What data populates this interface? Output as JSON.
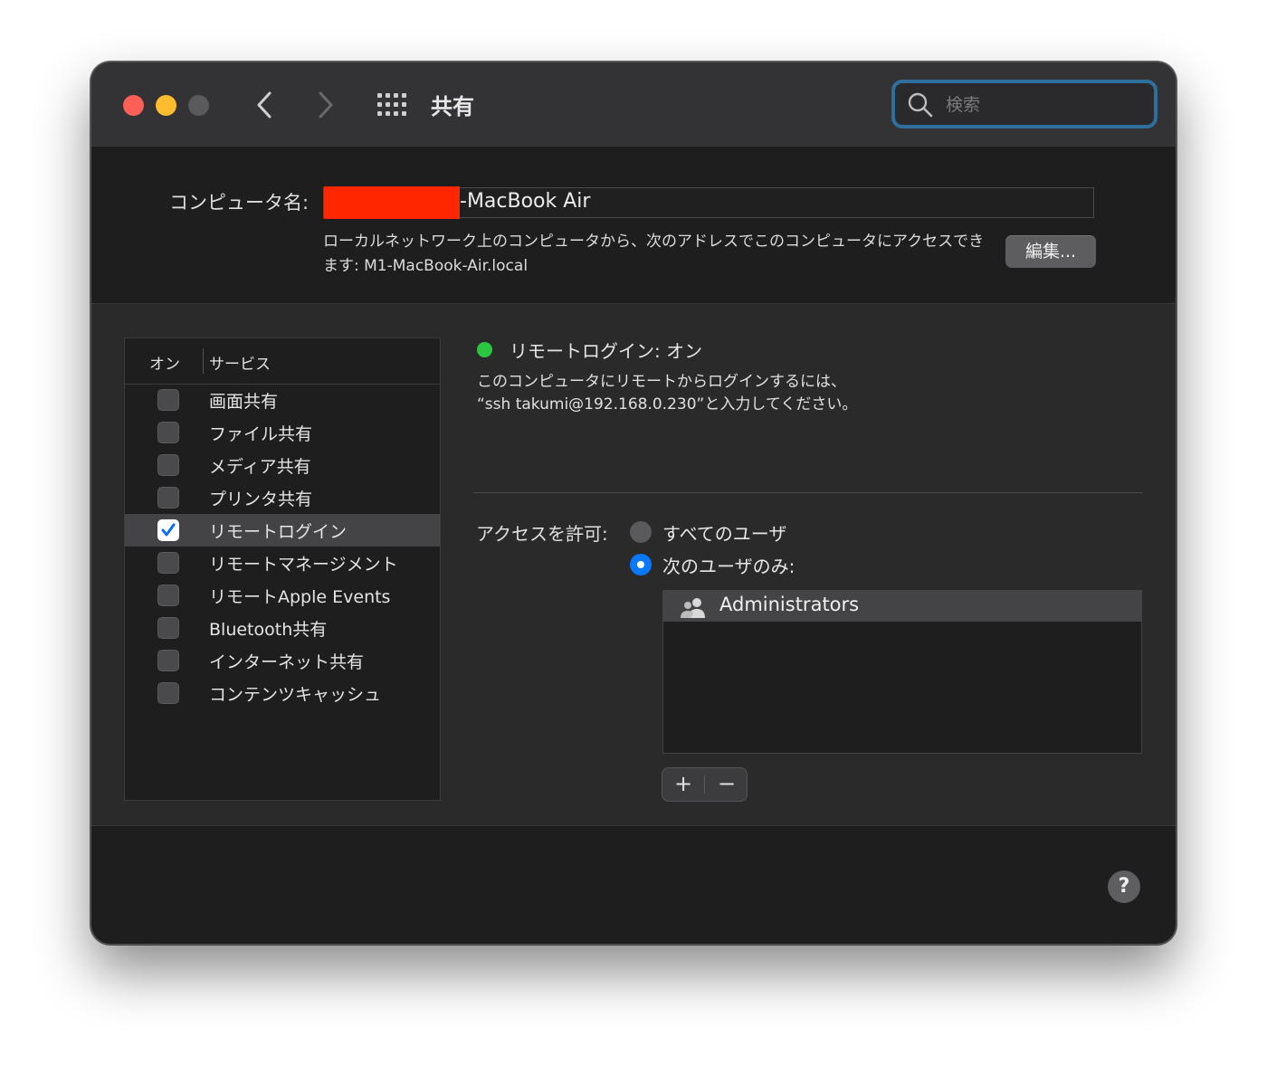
{
  "window": {
    "title": "共有"
  },
  "search": {
    "placeholder": "検索"
  },
  "computer_name": {
    "label": "コンピュータ名:",
    "value": "-MacBook Air",
    "description": "ローカルネットワーク上のコンピュータから、次のアドレスでこのコンピュータにアクセスできます: M1-MacBook-Air.local",
    "edit_label": "編集..."
  },
  "services": {
    "header_on": "オン",
    "header_service": "サービス",
    "items": [
      {
        "label": "画面共有",
        "checked": false
      },
      {
        "label": "ファイル共有",
        "checked": false
      },
      {
        "label": "メディア共有",
        "checked": false
      },
      {
        "label": "プリンタ共有",
        "checked": false
      },
      {
        "label": "リモートログイン",
        "checked": true
      },
      {
        "label": "リモートマネージメント",
        "checked": false
      },
      {
        "label": "リモートApple Events",
        "checked": false
      },
      {
        "label": "Bluetooth共有",
        "checked": false
      },
      {
        "label": "インターネット共有",
        "checked": false
      },
      {
        "label": "コンテンツキャッシュ",
        "checked": false
      }
    ]
  },
  "status": {
    "text": "リモートログイン: オン",
    "line1": "このコンピュータにリモートからログインするには、",
    "line2": "“ssh takumi@192.168.0.230”と入力してください。",
    "color": "#2ac840"
  },
  "access": {
    "label": "アクセスを許可:",
    "option_all": "すべてのユーザ",
    "option_some": "次のユーザのみ:",
    "users": [
      "Administrators"
    ]
  },
  "buttons": {
    "plus": "+",
    "minus": "−",
    "help": "?"
  }
}
